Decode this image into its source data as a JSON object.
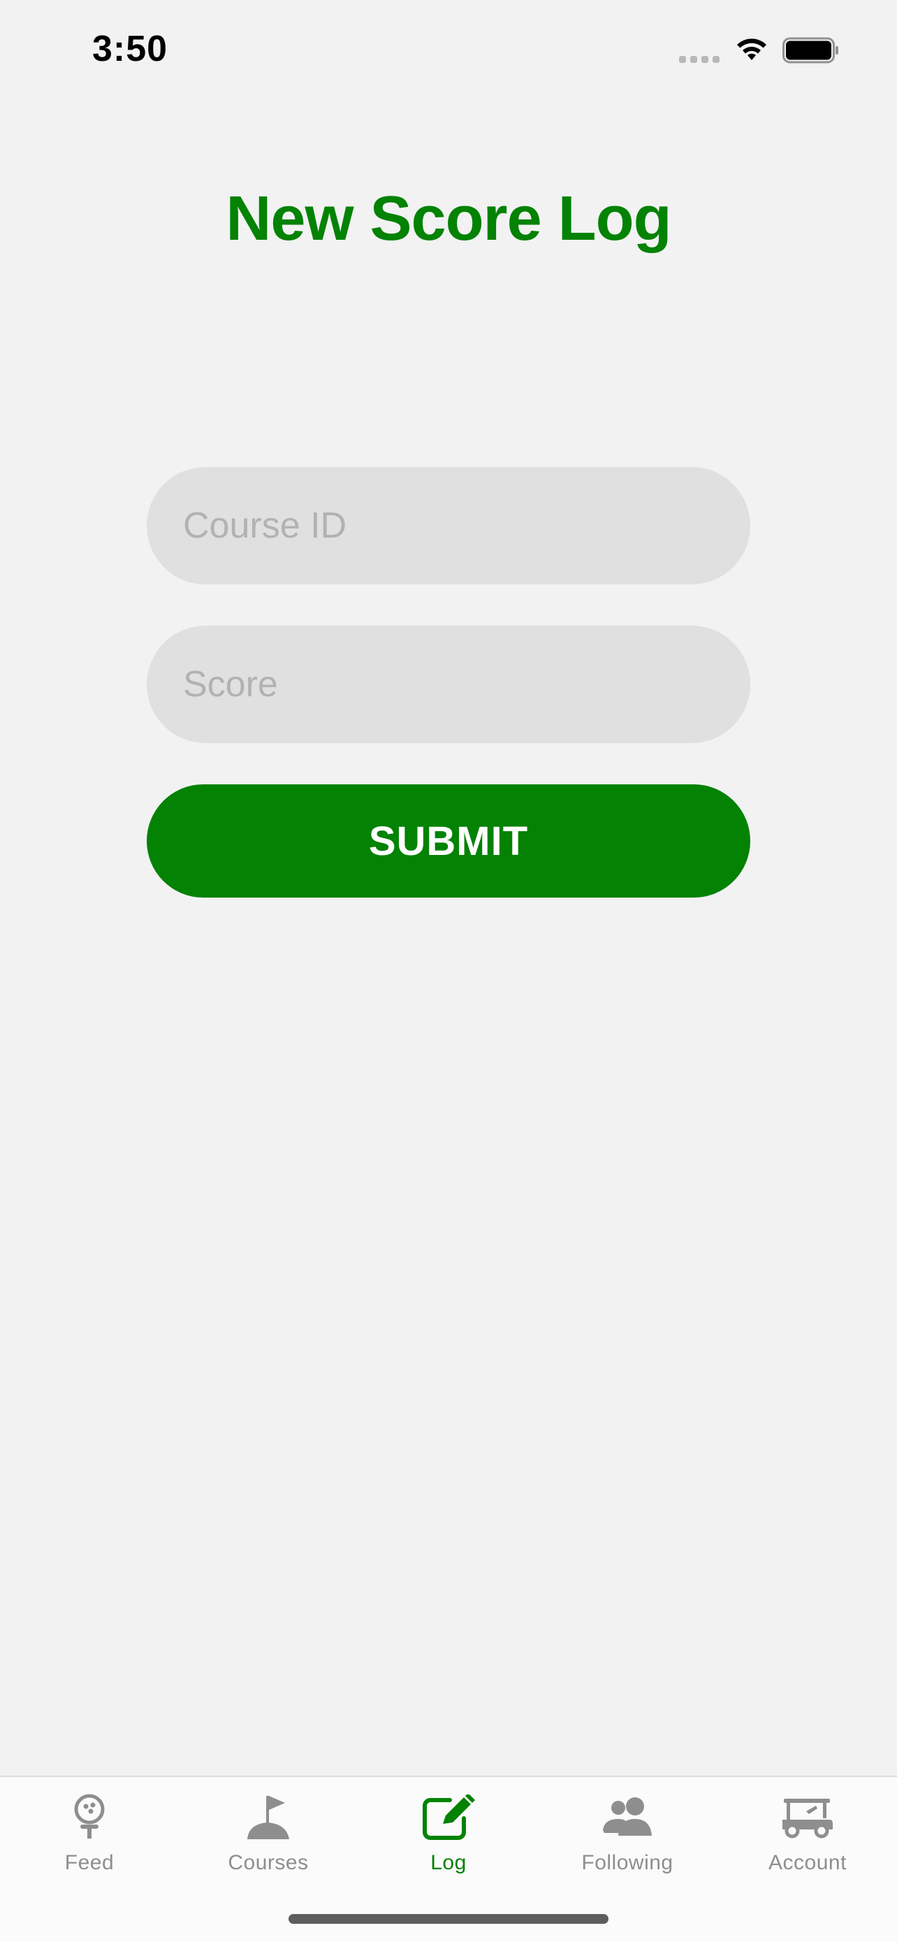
{
  "status_bar": {
    "time": "3:50"
  },
  "page": {
    "title": "New Score Log"
  },
  "form": {
    "course_id_placeholder": "Course ID",
    "course_id_value": "",
    "score_placeholder": "Score",
    "score_value": "",
    "submit_label": "SUBMIT"
  },
  "tab_bar": {
    "active_tab": "Log",
    "items": [
      {
        "label": "Feed",
        "icon": "golf-ball-tee-icon"
      },
      {
        "label": "Courses",
        "icon": "golf-flag-icon"
      },
      {
        "label": "Log",
        "icon": "edit-pencil-icon"
      },
      {
        "label": "Following",
        "icon": "users-icon"
      },
      {
        "label": "Account",
        "icon": "golf-cart-icon"
      }
    ]
  },
  "colors": {
    "accent": "#038203",
    "inactive": "#8e8e8e",
    "background": "#f2f2f2",
    "input_fill": "#e0e0e0"
  }
}
